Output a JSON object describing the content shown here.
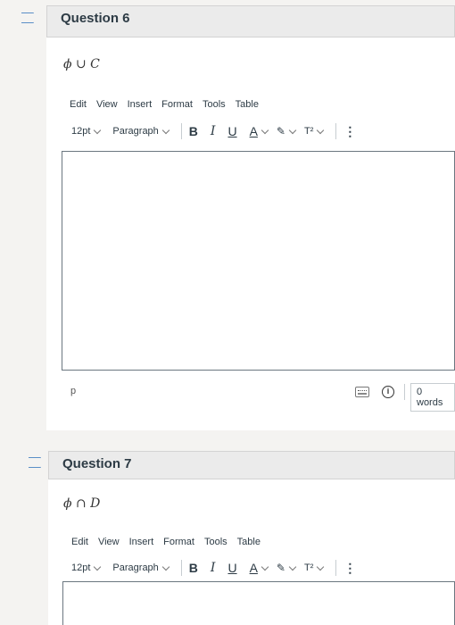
{
  "questions": [
    {
      "title": "Question 6",
      "expression": "ϕ ∪ C",
      "menu": [
        "Edit",
        "View",
        "Insert",
        "Format",
        "Tools",
        "Table"
      ],
      "font_size": "12pt",
      "block_format": "Paragraph",
      "status_path": "p",
      "word_count": "0 words"
    },
    {
      "title": "Question 7",
      "expression": "ϕ ∩ D",
      "menu": [
        "Edit",
        "View",
        "Insert",
        "Format",
        "Tools",
        "Table"
      ],
      "font_size": "12pt",
      "block_format": "Paragraph"
    }
  ],
  "format_buttons": {
    "bold": "B",
    "italic": "I",
    "underline": "U",
    "text_color": "A",
    "superscript": "T²",
    "more": "⋮"
  },
  "colors": {
    "header_bg": "#ebebeb",
    "flag": "#5b8fc7",
    "editor_border": "#6b7780"
  }
}
